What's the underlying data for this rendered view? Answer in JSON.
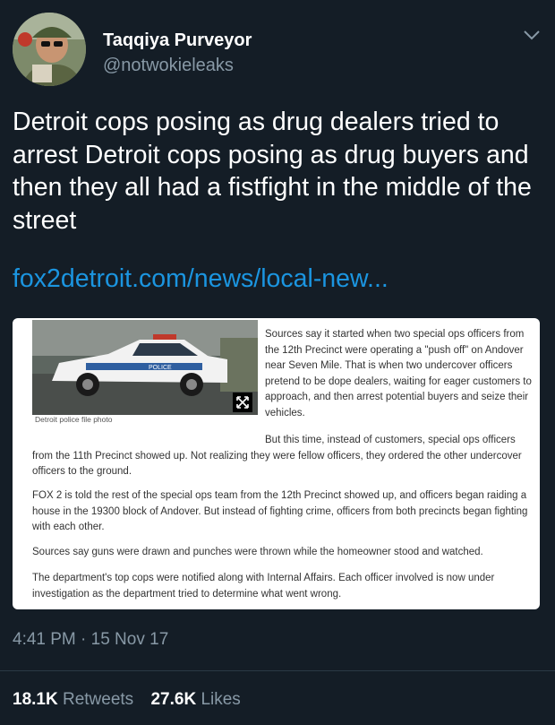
{
  "user": {
    "name": "Taqqiya Purveyor",
    "handle": "@notwokieleaks"
  },
  "tweet": {
    "text": "Detroit cops posing as drug dealers tried to arrest Detroit cops posing as drug buyers and then they all had a fistfight in the middle of the street",
    "link": "fox2detroit.com/news/local-new..."
  },
  "article": {
    "photo_caption": "Detroit police file photo",
    "paragraphs": [
      "Sources say it started when two special ops officers from the 12th Precinct were operating a \"push off\" on Andover near Seven Mile. That is when two undercover officers pretend to be dope dealers, waiting for eager customers to approach, and then arrest potential buyers and seize their vehicles.",
      "But this time, instead of customers, special ops officers from the 11th Precinct showed up. Not realizing they were fellow officers, they ordered the other undercover officers to the ground.",
      "FOX 2 is told the rest of the special ops team from the 12th Precinct showed up, and officers began raiding a house in the 19300 block of Andover. But instead of fighting crime, officers from both precincts began fighting with each other.",
      "Sources say guns were drawn and punches were thrown while the homeowner stood and watched.",
      "The department's top cops were notified along with Internal Affairs. Each officer involved is now under investigation as the department tried to determine what went wrong."
    ],
    "car_text": "POLICE"
  },
  "meta": {
    "timestamp": "4:41 PM · 15 Nov 17",
    "retweets_count": "18.1K",
    "retweets_label": "Retweets",
    "likes_count": "27.6K",
    "likes_label": "Likes"
  },
  "colors": {
    "background": "#141d26",
    "link": "#1b95e0",
    "secondary_text": "#8899a6"
  },
  "icons": [
    "avatar-photo",
    "chevron-down-icon",
    "expand-icon"
  ]
}
